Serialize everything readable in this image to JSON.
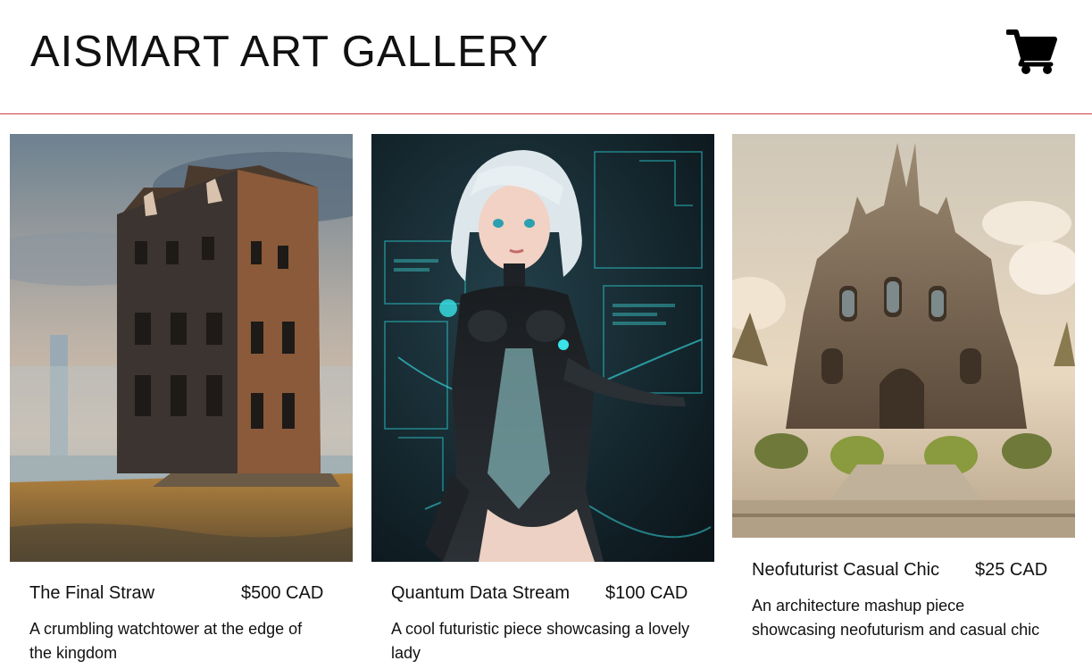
{
  "header": {
    "title": "AISMART ART GALLERY",
    "cart_icon": "shopping-cart-icon",
    "accent_line_color": "#c94040"
  },
  "gallery": {
    "items": [
      {
        "title": "The Final Straw",
        "price": "$500 CAD",
        "description": "A crumbling watchtower at the edge of the kingdom",
        "image": "ruined-watchtower-painting"
      },
      {
        "title": "Quantum Data Stream",
        "price": "$100 CAD",
        "description": "A cool futuristic piece showcasing a lovely lady",
        "image": "futuristic-cyber-girl-illustration"
      },
      {
        "title": "Neofuturist Casual Chic",
        "price": "$25 CAD",
        "description": "An architecture mashup piece showcasing neofuturism and casual chic",
        "image": "ornate-palace-architecture-render"
      }
    ]
  }
}
